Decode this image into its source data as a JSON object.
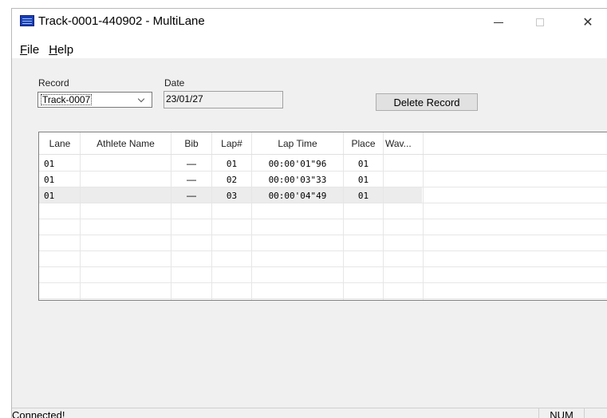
{
  "window": {
    "title": "Track-0001-440902 - MultiLane"
  },
  "menu": [
    {
      "label_mnemonic": "F",
      "label_rest": "ile"
    },
    {
      "label_mnemonic": "H",
      "label_rest": "elp"
    }
  ],
  "form": {
    "record_label": "Record",
    "record_value": "Track-0007",
    "date_label": "Date",
    "date_value": "23/01/27",
    "delete_button": "Delete Record"
  },
  "table": {
    "columns": [
      "Lane",
      "Athlete Name",
      "Bib",
      "Lap#",
      "Lap Time",
      "Place",
      "Wav..."
    ],
    "rows": [
      {
        "lane": "01",
        "athlete": "",
        "bib": "—",
        "lap": "01",
        "time": "00:00'01\"96",
        "place": "01",
        "wave": ""
      },
      {
        "lane": "01",
        "athlete": "",
        "bib": "—",
        "lap": "02",
        "time": "00:00'03\"33",
        "place": "01",
        "wave": ""
      },
      {
        "lane": "01",
        "athlete": "",
        "bib": "—",
        "lap": "03",
        "time": "00:00'04\"49",
        "place": "01",
        "wave": ""
      }
    ],
    "selected_row": 2
  },
  "status": {
    "text": "Connected!",
    "num": "NUM"
  },
  "colors": {
    "window_bg": "#f0f0f0",
    "titlebar_bg": "#ffffff",
    "app_icon": "#1a3fb5"
  },
  "icons": {
    "app": "multilane-app-icon",
    "minimize": "minimize-icon",
    "maximize": "maximize-icon",
    "close": "close-icon",
    "dropdown": "chevron-down-icon"
  }
}
